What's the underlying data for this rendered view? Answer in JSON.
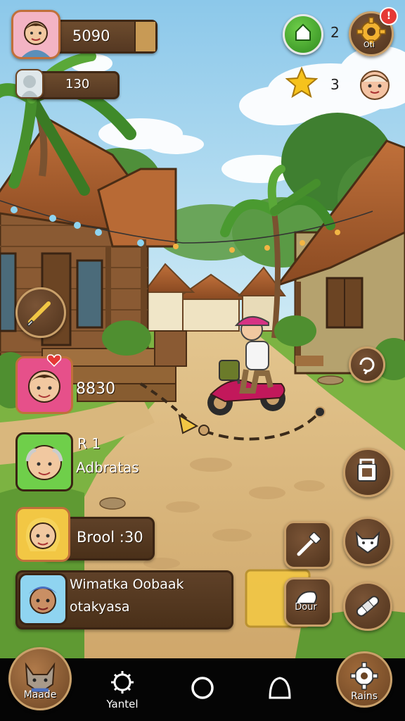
{
  "hud": {
    "coins": "5090",
    "secondary": "130",
    "green_count": "2",
    "star_count": "3",
    "notification_badge": "!",
    "settings_label": "Oti"
  },
  "players": [
    {
      "value": "8830"
    },
    {
      "line1": "R 1",
      "line2": "Adbratas"
    },
    {
      "value": "Brool :30"
    },
    {
      "line1": "Wimatka Oobaak",
      "line2": "otakyasa"
    }
  ],
  "actions": {
    "label_dour": "Dour"
  },
  "nav": {
    "item1": "Maade",
    "item2": "Yantel",
    "item5": "Rains"
  },
  "colors": {
    "sky": "#aad6ee",
    "grass": "#7cb342",
    "dirt": "#d8b47a",
    "wood": "#5a3a20",
    "accent": "#e53935"
  },
  "icons": [
    "person-avatar-icon",
    "green-leaf-icon",
    "gear-icon",
    "star-icon",
    "face-icon",
    "brush-icon",
    "refresh-icon",
    "cart-icon",
    "hammer-icon",
    "fox-icon",
    "shoe-icon",
    "bandage-icon",
    "fox-face-icon",
    "gear-nav-icon",
    "circle-nav-icon",
    "bell-nav-icon"
  ]
}
